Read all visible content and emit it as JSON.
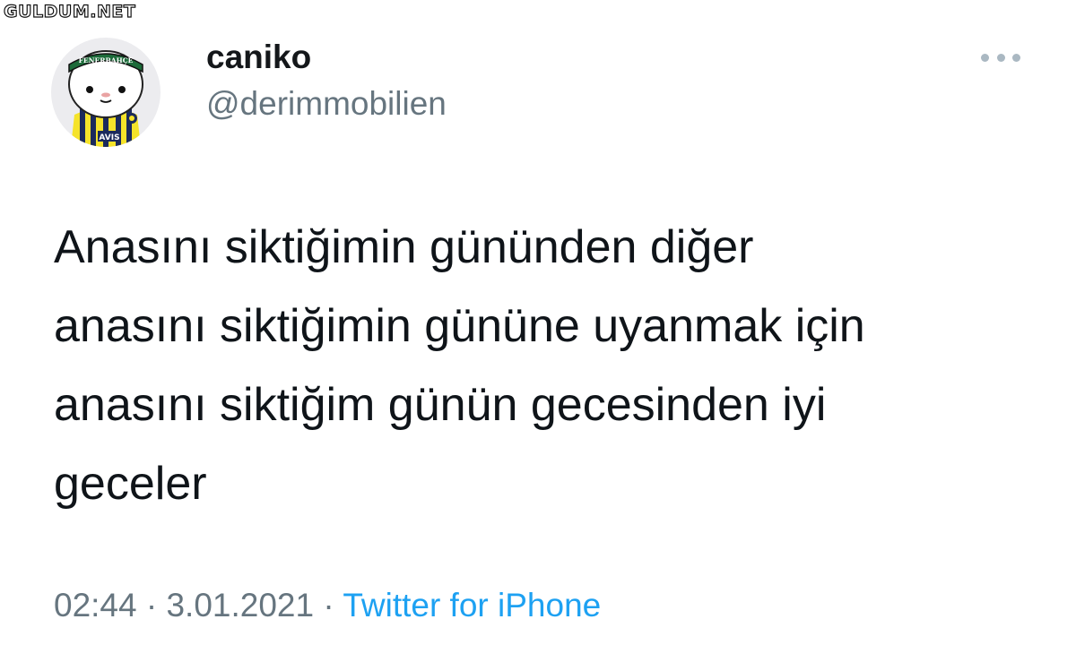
{
  "watermark": {
    "text": "GULDUM.NET"
  },
  "author": {
    "display_name": "caniko",
    "handle": "@derimmobilien",
    "avatar": {
      "icon": "cartoon-fan-avatar-icon",
      "headband_text": "FENERBAHÇE",
      "shirt_text": "AVIS",
      "colors": {
        "background": "#ececef",
        "jersey_yellow": "#f5e32a",
        "jersey_navy": "#1b2a5c"
      }
    }
  },
  "menu": {
    "icon": "more-options-icon"
  },
  "tweet": {
    "lines": [
      "Anasını siktiğimin gününden diğer",
      "anasını siktiğimin gününe uyanmak için",
      "anasını siktiğim günün gecesinden iyi",
      "geceler"
    ]
  },
  "meta": {
    "time": "02:44",
    "separator": " · ",
    "date": "3.01.2021",
    "source": "Twitter for iPhone"
  },
  "colors": {
    "text": "#0f1419",
    "secondary": "#66757f",
    "link": "#1da1f2"
  }
}
